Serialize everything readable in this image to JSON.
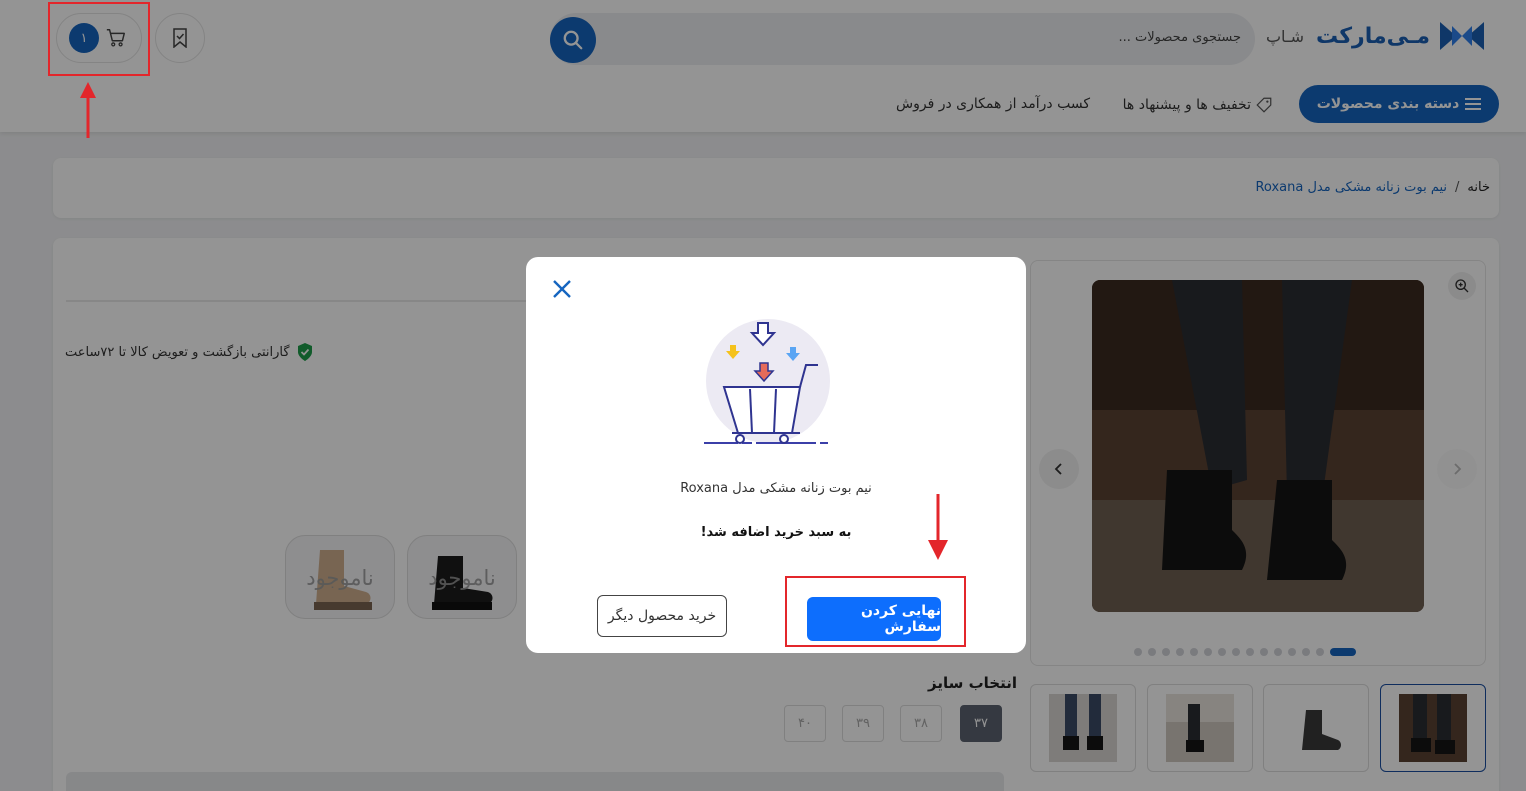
{
  "header": {
    "logo_text": "مـی‌مارکت",
    "logo_sub": "شـاپ",
    "search_placeholder": "جستجوی محصولات ...",
    "cart_count": "۱",
    "categories_label": "دسته بندی محصولات",
    "nav": {
      "discounts": "تخفیف ها و پیشنهاد ها",
      "affiliate": "کسب درآمد از همکاری در فروش"
    }
  },
  "breadcrumb": {
    "home": "خانه",
    "separator": "/",
    "current": "نیم بوت زنانه مشکی مدل Roxana"
  },
  "product": {
    "guarantee": "گارانتی بازگشت و تعویض کالا تا ۷۲ساعت",
    "variants": [
      {
        "label": "ناموجود"
      },
      {
        "label": "ناموجود"
      }
    ],
    "size_title": "انتخاب سایز",
    "sizes": [
      "۳۷",
      "۳۸",
      "۳۹",
      "۴۰"
    ],
    "selected_size": "۳۷"
  },
  "modal": {
    "product_name": "نیم بوت زنانه مشکی مدل Roxana",
    "message": "به سبد خرید اضافه شد!",
    "finalize_label": "نهایی کردن سفارش",
    "continue_label": "خرید محصول دیگر"
  },
  "colors": {
    "primary": "#1565c0",
    "annotation": "#e3262b"
  }
}
